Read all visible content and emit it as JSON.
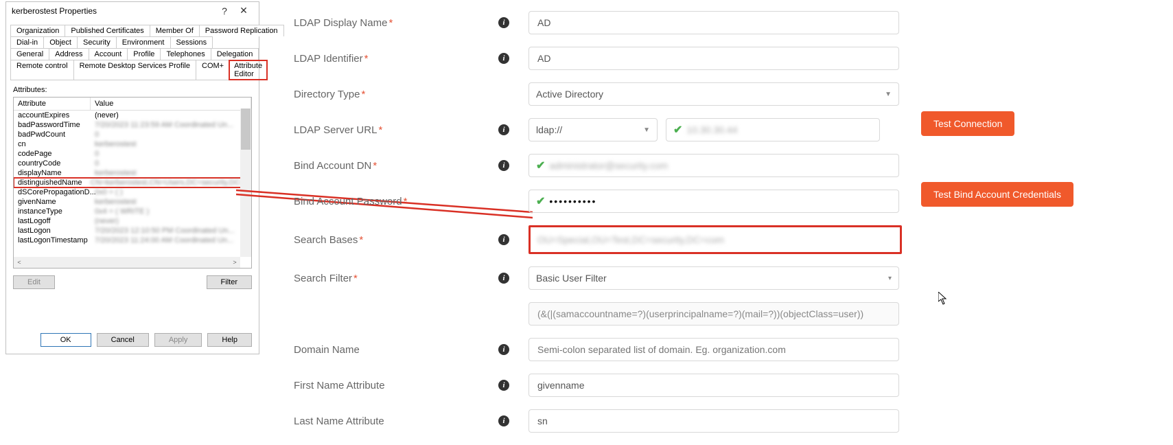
{
  "dialog": {
    "title": "kerberostest Properties",
    "help_icon": "?",
    "close_icon": "✕",
    "tab_rows": [
      [
        "Organization",
        "Published Certificates",
        "Member Of",
        "Password Replication"
      ],
      [
        "Dial-in",
        "Object",
        "Security",
        "Environment",
        "Sessions"
      ],
      [
        "General",
        "Address",
        "Account",
        "Profile",
        "Telephones",
        "Delegation"
      ],
      [
        "Remote control",
        "Remote Desktop Services Profile",
        "COM+",
        "Attribute Editor"
      ]
    ],
    "active_tab": "Attribute Editor",
    "attributes_label": "Attributes:",
    "col_attribute": "Attribute",
    "col_value": "Value",
    "attributes": [
      {
        "name": "accountExpires",
        "value": "(never)",
        "never": true
      },
      {
        "name": "badPasswordTime",
        "value": "7/20/2023 11:23:59 AM Coordinated Un..."
      },
      {
        "name": "badPwdCount",
        "value": "0"
      },
      {
        "name": "cn",
        "value": "kerberostest"
      },
      {
        "name": "codePage",
        "value": "0"
      },
      {
        "name": "countryCode",
        "value": "0"
      },
      {
        "name": "displayName",
        "value": "kerberostest"
      },
      {
        "name": "distinguishedName",
        "value": "CN=kerberostest,CN=Users,DC=security,DC=c",
        "highlight": true
      },
      {
        "name": "dSCorePropagationD...",
        "value": "0x0 = (  )"
      },
      {
        "name": "givenName",
        "value": "kerberostest"
      },
      {
        "name": "instanceType",
        "value": "0x4 = ( WRITE )"
      },
      {
        "name": "lastLogoff",
        "value": "(never)"
      },
      {
        "name": "lastLogon",
        "value": "7/20/2023 12:10:50 PM Coordinated Un..."
      },
      {
        "name": "lastLogonTimestamp",
        "value": "7/20/2023 11:24:00 AM Coordinated Un..."
      }
    ],
    "edit_btn": "Edit",
    "filter_btn": "Filter",
    "ok_btn": "OK",
    "cancel_btn": "Cancel",
    "apply_btn": "Apply",
    "help_btn": "Help"
  },
  "form": {
    "ldap_display_name": {
      "label": "LDAP Display Name",
      "value": "AD"
    },
    "ldap_identifier": {
      "label": "LDAP Identifier",
      "value": "AD"
    },
    "directory_type": {
      "label": "Directory Type",
      "value": "Active Directory"
    },
    "ldap_server_url": {
      "label": "LDAP Server URL",
      "scheme": "ldap://",
      "host": "10.30.30.44"
    },
    "bind_dn": {
      "label": "Bind Account DN",
      "value": "administrator@security.com"
    },
    "bind_pw": {
      "label": "Bind Account Password",
      "value": "••••••••••"
    },
    "search_bases": {
      "label": "Search Bases",
      "value": "OU=Special,OU=Test,DC=security,DC=com"
    },
    "search_filter": {
      "label": "Search Filter",
      "value": "Basic User Filter",
      "expr": "(&(|(samaccountname=?)(userprincipalname=?)(mail=?))(objectClass=user))"
    },
    "domain_name": {
      "label": "Domain Name",
      "placeholder": "Semi-colon separated list of domain. Eg. organization.com"
    },
    "first_name_attr": {
      "label": "First Name Attribute",
      "value": "givenname"
    },
    "last_name_attr": {
      "label": "Last Name Attribute",
      "value": "sn"
    },
    "test_connection_btn": "Test Connection",
    "test_bind_btn": "Test Bind Account Credentials"
  }
}
